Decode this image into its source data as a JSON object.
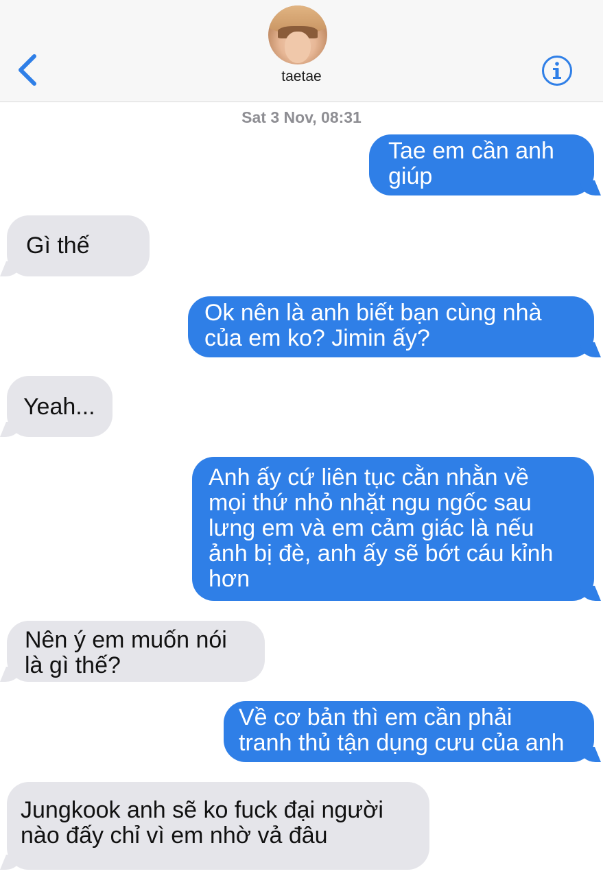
{
  "header": {
    "contact_name": "taetae",
    "accent_color": "#2f7fe7"
  },
  "thread": {
    "timestamp": "Sat 3 Nov, 08:31",
    "messages": [
      {
        "direction": "sent",
        "text": "Tae em cần anh\ngiúp"
      },
      {
        "direction": "received",
        "text": "Gì thế"
      },
      {
        "direction": "sent",
        "text": "Ok nên là anh biết bạn cùng nhà\ncủa em ko? Jimin ấy?"
      },
      {
        "direction": "received",
        "text": "Yeah..."
      },
      {
        "direction": "sent",
        "text": "Anh ấy cứ liên tục cằn nhằn về\nmọi thứ nhỏ nhặt ngu ngốc sau\nlưng em và em cảm giác là nếu\nảnh bị đè, anh ấy sẽ bớt cáu kỉnh\nhơn"
      },
      {
        "direction": "received",
        "text": "Nên ý em muốn nói\nlà gì thế?"
      },
      {
        "direction": "sent",
        "text": "Về cơ bản thì em cần phải\ntranh thủ tận dụng cưu của anh"
      },
      {
        "direction": "received",
        "text": "Jungkook anh sẽ ko fuck đại người\nnào đấy chỉ vì em nhờ vả đâu"
      }
    ]
  },
  "colors": {
    "sent_bubble": "#2f7fe7",
    "received_bubble": "#e5e5ea",
    "header_background": "#f7f7f7",
    "timestamp_text": "#8e8e93"
  }
}
